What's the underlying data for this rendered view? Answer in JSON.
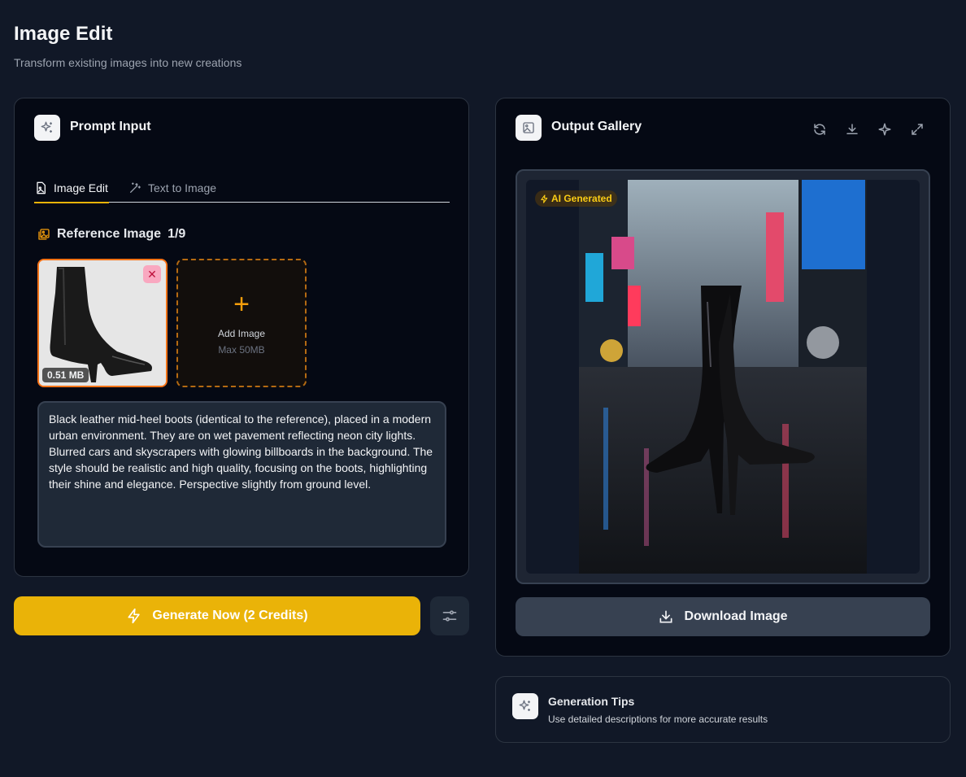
{
  "page": {
    "title": "Image Edit",
    "subtitle": "Transform existing images into new creations"
  },
  "prompt_panel": {
    "title": "Prompt Input",
    "title_icon": "sparkles-icon",
    "tabs": [
      {
        "label": "Image Edit",
        "icon": "file-image-icon",
        "active": true
      },
      {
        "label": "Text to Image",
        "icon": "magic-wand-icon",
        "active": false
      }
    ],
    "reference": {
      "label": "Reference Image",
      "count": "1/9",
      "icon": "image-stack-icon",
      "thumbnail_size": "0.51 MB",
      "remove_icon": "close-icon"
    },
    "add_image": {
      "label": "Add Image",
      "sublabel": "Max 50MB",
      "icon": "plus-icon"
    },
    "prompt_value": "Black leather mid-heel boots (identical to the reference), placed in a modern urban environment. They are on wet pavement reflecting neon city lights. Blurred cars and skyscrapers with glowing billboards in the background. The style should be realistic and high quality, focusing on the boots, highlighting their shine and elegance. Perspective slightly from ground level."
  },
  "actions": {
    "generate_label": "Generate Now (2 Credits)",
    "generate_icon": "lightning-icon",
    "settings_icon": "sliders-icon"
  },
  "output_panel": {
    "title": "Output Gallery",
    "title_icon": "image-icon",
    "toolbar_icons": [
      "refresh-icon",
      "download-icon",
      "sparkle-icon",
      "expand-icon"
    ],
    "badge": "AI Generated",
    "download_label": "Download Image"
  },
  "tips": {
    "title": "Generation Tips",
    "text": "Use detailed descriptions for more accurate results"
  },
  "colors": {
    "background": "#111827",
    "card": "#050914",
    "accent": "#eab308",
    "orange": "#f97316"
  }
}
